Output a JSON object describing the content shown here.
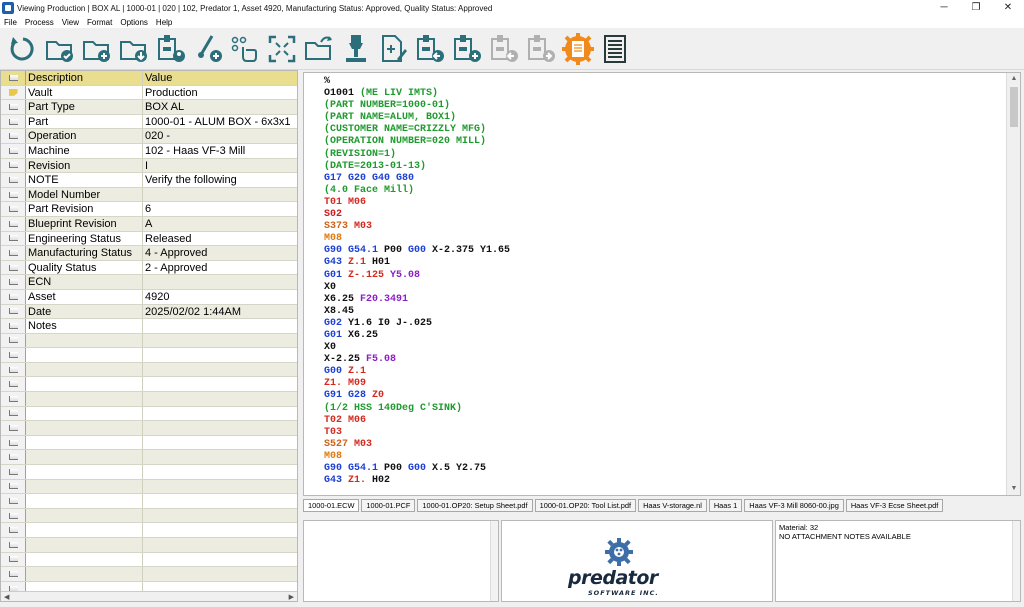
{
  "window": {
    "title": "Viewing Production | BOX AL | 1000-01 | 020 | 102, Predator 1, Asset 4920, Manufacturing Status: Approved, Quality Status: Approved",
    "minimize": "─",
    "restore": "❐",
    "close": "✕"
  },
  "menu": [
    "File",
    "Process",
    "View",
    "Format",
    "Options",
    "Help"
  ],
  "toolbar": [
    {
      "name": "refresh-icon",
      "color": "#2a6f7a"
    },
    {
      "name": "approve-folder-icon",
      "color": "#2a6f7a"
    },
    {
      "name": "add-folder-icon",
      "color": "#2a6f7a"
    },
    {
      "name": "download-folder-icon",
      "color": "#2a6f7a"
    },
    {
      "name": "machine-user-icon",
      "color": "#2a6f7a"
    },
    {
      "name": "probe-add-icon",
      "color": "#2a6f7a"
    },
    {
      "name": "touch-list-icon",
      "color": "#2a6f7a"
    },
    {
      "name": "expand-icon",
      "color": "#2a6f7a"
    },
    {
      "name": "open-folder-icon",
      "color": "#2a6f7a"
    },
    {
      "name": "spindle-icon",
      "color": "#2a6f7a"
    },
    {
      "name": "edit-document-icon",
      "color": "#2a6f7a"
    },
    {
      "name": "machine-receive-icon",
      "color": "#2a6f7a"
    },
    {
      "name": "machine-add-icon",
      "color": "#2a6f7a"
    },
    {
      "name": "machine-back-disabled-icon",
      "color": "#b0b0b0"
    },
    {
      "name": "machine-send-disabled-icon",
      "color": "#b0b0b0"
    },
    {
      "name": "settings-document-icon",
      "color": "#f08a1c"
    },
    {
      "name": "document-list-icon",
      "color": "#2a3a3a"
    }
  ],
  "grid": {
    "header": {
      "description": "Description",
      "value": "Value"
    },
    "rows": [
      {
        "description": "Vault",
        "value": "Production"
      },
      {
        "description": "Part Type",
        "value": "BOX AL"
      },
      {
        "description": "Part",
        "value": "1000-01 - ALUM BOX - 6x3x1"
      },
      {
        "description": "Operation",
        "value": "020 -"
      },
      {
        "description": "Machine",
        "value": "102 - Haas VF-3 Mill"
      },
      {
        "description": "Revision",
        "value": "I"
      },
      {
        "description": "NOTE",
        "value": "Verify the following"
      },
      {
        "description": "Model Number",
        "value": ""
      },
      {
        "description": "Part Revision",
        "value": "6"
      },
      {
        "description": "Blueprint Revision",
        "value": "A"
      },
      {
        "description": "Engineering Status",
        "value": "Released"
      },
      {
        "description": "Manufacturing Status",
        "value": "4 - Approved"
      },
      {
        "description": "Quality Status",
        "value": "2 - Approved"
      },
      {
        "description": "ECN",
        "value": ""
      },
      {
        "description": "Asset",
        "value": "4920"
      },
      {
        "description": "Date",
        "value": "2025/02/02  1:44AM"
      },
      {
        "description": "Notes",
        "value": ""
      },
      {
        "description": "",
        "value": ""
      },
      {
        "description": "",
        "value": ""
      },
      {
        "description": "",
        "value": ""
      },
      {
        "description": "",
        "value": ""
      },
      {
        "description": "",
        "value": ""
      },
      {
        "description": "",
        "value": ""
      },
      {
        "description": "",
        "value": ""
      },
      {
        "description": "",
        "value": ""
      },
      {
        "description": "",
        "value": ""
      },
      {
        "description": "",
        "value": ""
      },
      {
        "description": "",
        "value": ""
      },
      {
        "description": "",
        "value": ""
      },
      {
        "description": "",
        "value": ""
      },
      {
        "description": "",
        "value": ""
      },
      {
        "description": "",
        "value": ""
      },
      {
        "description": "",
        "value": ""
      },
      {
        "description": "",
        "value": ""
      },
      {
        "description": "",
        "value": ""
      }
    ]
  },
  "colors": {
    "comment": "#1f9a2e",
    "gcode": "#1c3fd6",
    "mcode": "#d22a1f",
    "tool": "#d22a1f",
    "spindle": "#cc1b1b",
    "m08": "#e07a10",
    "feed": "#8a1fc6",
    "axis": "#8a1fc6",
    "plain": "#111111",
    "s373": "#d06016",
    "grid_header": "#e9dd90",
    "grid_alt": "#ecece0"
  },
  "code": [
    [
      {
        "t": "%",
        "c": "plain"
      }
    ],
    [
      {
        "t": "O1001 ",
        "c": "plain"
      },
      {
        "t": "(ME LIV IMTS)",
        "c": "comment"
      }
    ],
    [
      {
        "t": "(PART NUMBER=1000-01)",
        "c": "comment"
      }
    ],
    [
      {
        "t": "(PART NAME=ALUM, BOX1)",
        "c": "comment"
      }
    ],
    [
      {
        "t": "(CUSTOMER NAME=CRIZZLY MFG)",
        "c": "comment"
      }
    ],
    [
      {
        "t": "(OPERATION NUMBER=020 MILL)",
        "c": "comment"
      }
    ],
    [
      {
        "t": "(REVISION=1)",
        "c": "comment"
      }
    ],
    [
      {
        "t": "(DATE=2013-01-13)",
        "c": "comment"
      }
    ],
    [
      {
        "t": "G17 G20 G40 G80",
        "c": "gcode"
      }
    ],
    [
      {
        "t": "(4.0 Face Mill)",
        "c": "comment"
      }
    ],
    [
      {
        "t": "T01 M06",
        "c": "tool"
      }
    ],
    [
      {
        "t": "S02",
        "c": "spindle"
      }
    ],
    [
      {
        "t": "S373 ",
        "c": "s373"
      },
      {
        "t": "M03",
        "c": "mcode"
      }
    ],
    [
      {
        "t": "M08",
        "c": "m08"
      }
    ],
    [
      {
        "t": "G90 G54.1 ",
        "c": "gcode"
      },
      {
        "t": "P00 ",
        "c": "plain"
      },
      {
        "t": "G00 ",
        "c": "gcode"
      },
      {
        "t": "X-2.375 Y1.65",
        "c": "plain"
      }
    ],
    [
      {
        "t": "G43 ",
        "c": "gcode"
      },
      {
        "t": "Z.1 ",
        "c": "tool"
      },
      {
        "t": "H01",
        "c": "plain"
      }
    ],
    [
      {
        "t": "G01 ",
        "c": "gcode"
      },
      {
        "t": "Z-.125 ",
        "c": "tool"
      },
      {
        "t": "Y5.08",
        "c": "axis"
      }
    ],
    [
      {
        "t": "X0",
        "c": "plain"
      }
    ],
    [
      {
        "t": "X6.25 ",
        "c": "plain"
      },
      {
        "t": "F20.3491",
        "c": "feed"
      }
    ],
    [
      {
        "t": "X8.45",
        "c": "plain"
      }
    ],
    [
      {
        "t": "G02 ",
        "c": "gcode"
      },
      {
        "t": "Y1.6 I0 J-.025",
        "c": "plain"
      }
    ],
    [
      {
        "t": "G01 ",
        "c": "gcode"
      },
      {
        "t": "X6.25",
        "c": "plain"
      }
    ],
    [
      {
        "t": "X0",
        "c": "plain"
      }
    ],
    [
      {
        "t": "X-2.25 ",
        "c": "plain"
      },
      {
        "t": "F5.08",
        "c": "feed"
      }
    ],
    [
      {
        "t": "G00 ",
        "c": "gcode"
      },
      {
        "t": "Z.1",
        "c": "tool"
      }
    ],
    [
      {
        "t": "Z1. M09",
        "c": "tool"
      }
    ],
    [
      {
        "t": "G91 G28 ",
        "c": "gcode"
      },
      {
        "t": "Z0",
        "c": "tool"
      }
    ],
    [
      {
        "t": "(1/2 HSS 140Deg C'SINK)",
        "c": "comment"
      }
    ],
    [
      {
        "t": "T02 M06",
        "c": "tool"
      }
    ],
    [
      {
        "t": "T03",
        "c": "tool"
      }
    ],
    [
      {
        "t": "S527 ",
        "c": "s373"
      },
      {
        "t": "M03",
        "c": "mcode"
      }
    ],
    [
      {
        "t": "M08",
        "c": "m08"
      }
    ],
    [
      {
        "t": "G90 G54.1 ",
        "c": "gcode"
      },
      {
        "t": "P00 ",
        "c": "plain"
      },
      {
        "t": "G00 ",
        "c": "gcode"
      },
      {
        "t": "X.5 Y2.75",
        "c": "plain"
      }
    ],
    [
      {
        "t": "G43 ",
        "c": "gcode"
      },
      {
        "t": "Z1. ",
        "c": "tool"
      },
      {
        "t": "H02",
        "c": "plain"
      }
    ]
  ],
  "tabs": [
    "1000-01.ECW",
    "1000-01.PCF",
    "1000-01.OP20: Setup Sheet.pdf",
    "1000-01.OP20: Tool List.pdf",
    "Haas V-storage.nl",
    "Haas 1",
    "Haas VF-3 Mill 8060-00.jpg",
    "Haas VF-3 Ecse Sheet.pdf"
  ],
  "attachment_notes": {
    "material": "Material: 32",
    "status": "NO ATTACHMENT NOTES AVAILABLE"
  },
  "logo": {
    "word": "predator",
    "sub": "SOFTWARE INC."
  }
}
